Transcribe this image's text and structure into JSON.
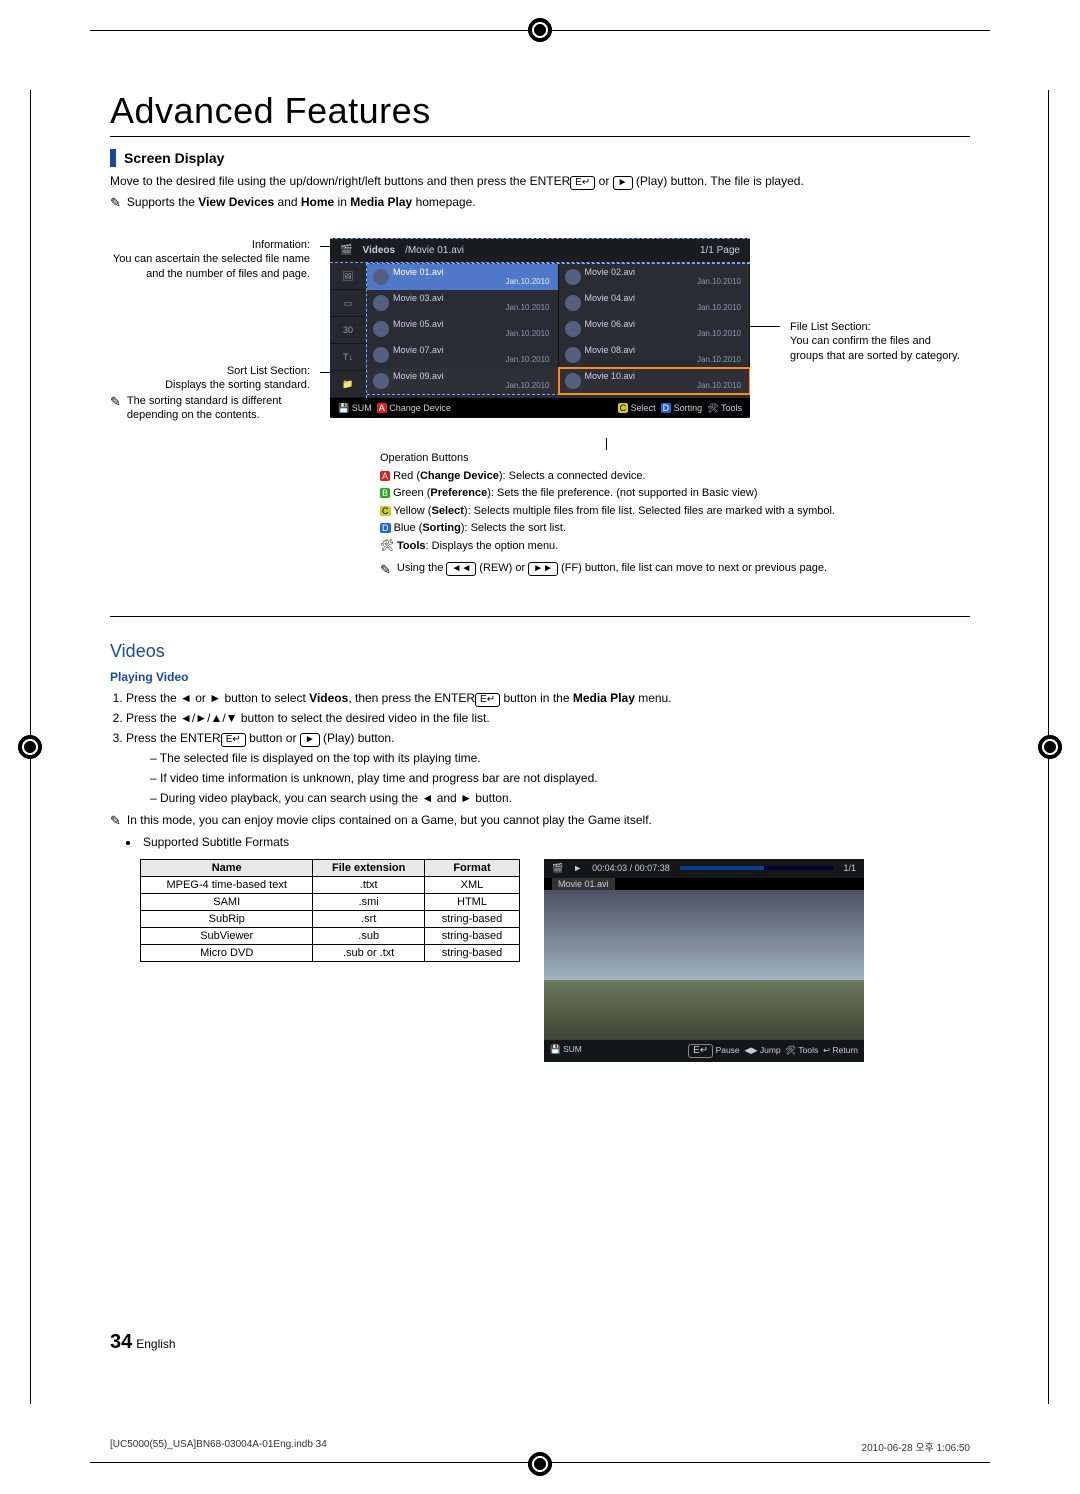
{
  "page": {
    "title": "Advanced Features",
    "section1": "Screen Display",
    "intro1": "Move to the desired file using the up/down/right/left buttons and then press the ENTER",
    "intro2": " or ",
    "intro3": " (Play) button. The file is played.",
    "note1_pre": "Supports the ",
    "note1_b1": "View Devices",
    "note1_mid": " and ",
    "note1_b2": "Home",
    "note1_mid2": " in ",
    "note1_b3": "Media Play",
    "note1_post": " homepage."
  },
  "callouts": {
    "info_title": "Information:",
    "info_text": "You can ascertain the selected file name and the number of files and page.",
    "sort_title": "Sort List Section:",
    "sort_text": "Displays the sorting standard.",
    "sort_note": "The sorting standard is different depending on the contents.",
    "right_title": "File List Section:",
    "right_text": "You can confirm the files and groups that are sorted by category."
  },
  "tv": {
    "cat": "Videos",
    "crumb": "/Movie 01.avi",
    "pageinfo": "1/1 Page",
    "files": [
      {
        "name": "Movie 01.avi",
        "date": "Jan.10.2010",
        "sel": true
      },
      {
        "name": "Movie 02.avi",
        "date": "Jan.10.2010"
      },
      {
        "name": "Movie 03.avi",
        "date": "Jan.10.2010"
      },
      {
        "name": "Movie 04.avi",
        "date": "Jan.10.2010"
      },
      {
        "name": "Movie 05.avi",
        "date": "Jan.10.2010"
      },
      {
        "name": "Movie 06.avi",
        "date": "Jan.10.2010"
      },
      {
        "name": "Movie 07.avi",
        "date": "Jan.10.2010"
      },
      {
        "name": "Movie 08.avi",
        "date": "Jan.10.2010"
      },
      {
        "name": "Movie 09.avi",
        "date": "Jan.10.2010"
      },
      {
        "name": "Movie 10.avi",
        "date": "Jan.10.2010",
        "orange": true
      }
    ],
    "footer_left_sum": "SUM",
    "footer_left_cd": "Change Device",
    "footer_select": "Select",
    "footer_sorting": "Sorting",
    "footer_tools": "Tools"
  },
  "op": {
    "heading": "Operation Buttons",
    "a": "Red (",
    "a_b": "Change Device",
    "a2": "): Selects a connected device.",
    "b": "Green (",
    "b_b": "Preference",
    "b2": "): Sets the file preference. (not supported in Basic view)",
    "c": "Yellow (",
    "c_b": "Select",
    "c2": "): Selects multiple files from file list. Selected files are marked with a symbol.",
    "d": "Blue (",
    "d_b": "Sorting",
    "d2": "): Selects the sort list.",
    "tools_b": "Tools",
    "tools2": ": Displays the option menu.",
    "rew_note_a": "Using the ",
    "rew_note_b": " (REW) or ",
    "rew_note_c": " (FF) button, file list can move to next or previous page."
  },
  "videos": {
    "heading": "Videos",
    "sub": "Playing Video",
    "s1a": "Press the ◄ or ► button to select ",
    "s1b": "Videos",
    "s1c": ", then press the ENTER",
    "s1d": " button in the ",
    "s1e": "Media Play",
    "s1f": " menu.",
    "s2": "Press the ◄/►/▲/▼ button to select the desired video in the file list.",
    "s3a": "Press the ENTER",
    "s3b": " button or ",
    "s3c": " (Play) button.",
    "b1": "The selected file is displayed on the top with its playing time.",
    "b2": "If video time information is unknown, play time and progress bar are not displayed.",
    "b3": "During video playback, you can search using the ◄ and ► button.",
    "note2a": "In this mode, you can enjoy movie clips contained on a Game, but you cannot play the Game itself.",
    "bul1": "Supported Subtitle Formats"
  },
  "table": {
    "h1": "Name",
    "h2": "File extension",
    "h3": "Format",
    "rows": [
      {
        "n": "MPEG-4 time-based text",
        "e": ".ttxt",
        "f": "XML"
      },
      {
        "n": "SAMI",
        "e": ".smi",
        "f": "HTML"
      },
      {
        "n": "SubRip",
        "e": ".srt",
        "f": "string-based"
      },
      {
        "n": "SubViewer",
        "e": ".sub",
        "f": "string-based"
      },
      {
        "n": "Micro DVD",
        "e": ".sub or .txt",
        "f": "string-based"
      }
    ]
  },
  "player": {
    "file": "Movie 01.avi",
    "time": "00:04:03 / 00:07:38",
    "page": "1/1",
    "sum": "SUM",
    "pause": "Pause",
    "jump": "Jump",
    "tools": "Tools",
    "return": "Return"
  },
  "footer": {
    "page": "34",
    "lang": "English",
    "docinfo": "[UC5000(55)_USA]BN68-03004A-01Eng.indb   34",
    "date": "2010-06-28   오후 1:06:50"
  },
  "icons": {
    "enter": "E↵",
    "play": "►",
    "rew": "◄◄",
    "ff": "►►",
    "note": "✎",
    "tools": "🛠"
  }
}
